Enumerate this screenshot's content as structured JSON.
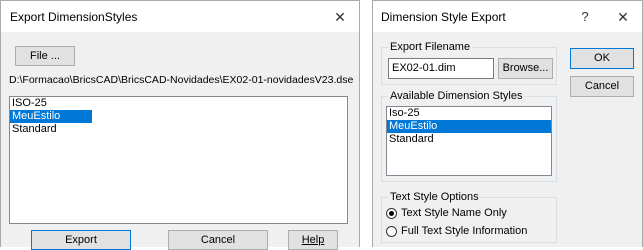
{
  "export_dlg": {
    "title": "Export DimensionStyles",
    "file_btn": "File ...",
    "path": "D:\\Formacao\\BricsCAD\\BricsCAD-Novidades\\EX02-01-novidadesV23.dse",
    "styles": [
      "ISO-25",
      "MeuEstilo",
      "Standard"
    ],
    "selected": "MeuEstilo",
    "export_btn": "Export",
    "cancel_btn": "Cancel",
    "help_btn": "Help"
  },
  "ds_dlg": {
    "title": "Dimension Style Export",
    "help_glyph": "?",
    "filename_group": "Export Filename",
    "filename_value": "EX02-01.dim",
    "browse_btn": "Browse...",
    "available_group": "Available Dimension Styles",
    "styles": [
      "Iso-25",
      "MeuEstilo",
      "Standard"
    ],
    "selected": "MeuEstilo",
    "text_group": "Text Style Options",
    "opt1": "Text Style Name Only",
    "opt2": "Full Text Style Information",
    "ok_btn": "OK",
    "cancel_btn": "Cancel"
  },
  "icons": {
    "close": "close-icon",
    "radio_selected": "radio-selected-icon",
    "radio_unselected": "radio-unselected-icon"
  },
  "colors": {
    "selection": "#0078d7",
    "dialog_bg": "#f0f0f0"
  }
}
